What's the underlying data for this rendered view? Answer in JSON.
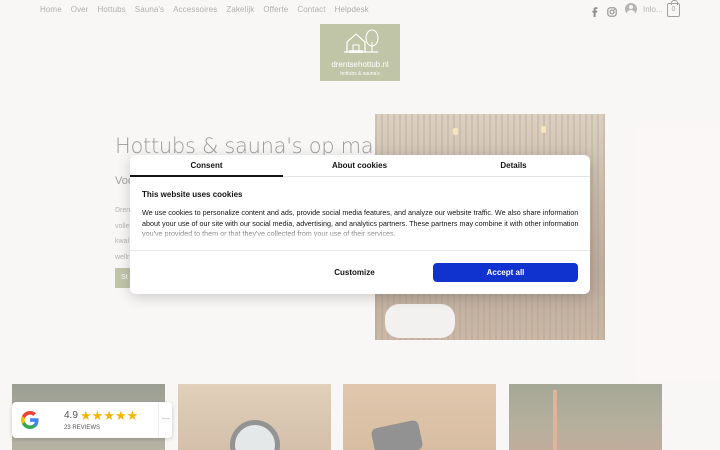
{
  "nav": {
    "links": [
      "Home",
      "Over",
      "Hottubs",
      "Sauna's",
      "Accessoires",
      "Zakelijk",
      "Offerte",
      "Contact",
      "Helpdesk"
    ],
    "login_label": "Inlo...",
    "cart_count": "0"
  },
  "logo": {
    "title": "drentsehottub.nl",
    "subtitle": "hottubs & sauna's"
  },
  "hero": {
    "title": "Hottubs & sauna's op maat",
    "subtitle": "Voo",
    "body_lines": [
      "Dren",
      "volle",
      "kwal",
      "wellr"
    ],
    "button_label": "St"
  },
  "reviews": {
    "rating": "4.9",
    "stars": "★★★★★",
    "count": "23 REVIEWS",
    "arrow": "—"
  },
  "cookie_dialog": {
    "tabs": [
      "Consent",
      "About cookies",
      "Details"
    ],
    "heading": "This website uses cookies",
    "body": "We use cookies to personalize content and ads, provide social media features, and analyze our website traffic. We also share information about your use of our site with our social media, advertising, and analytics partners. These partners may combine it with other information you've provided to them or that they've collected from your use of their services.",
    "customize_label": "Customize",
    "accept_label": "Accept all"
  },
  "colors": {
    "page_background": "#f5f1ee",
    "brand_olive": "#8f9562",
    "accept_blue": "#1032cf",
    "star_gold": "#f4b400"
  }
}
